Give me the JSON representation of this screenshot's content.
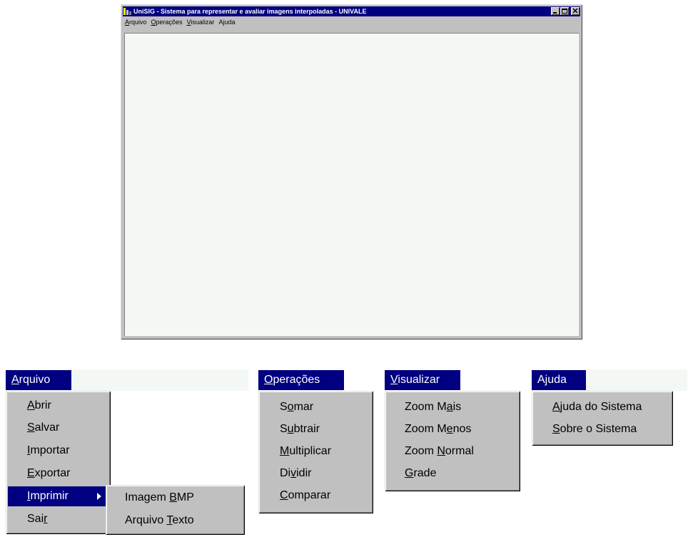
{
  "window": {
    "title": "UniSIG - Sistema para representar e avaliar imagens interpoladas - UNIVALE",
    "menu": [
      "Arquivo",
      "Operações",
      "Visualizar",
      "Ajuda"
    ]
  },
  "menus": {
    "arquivo": {
      "header": [
        "",
        "A",
        "rquivo"
      ],
      "items": [
        [
          "",
          "A",
          "brir"
        ],
        [
          "",
          "S",
          "alvar"
        ],
        [
          "",
          "I",
          "mportar"
        ],
        [
          "",
          "E",
          "xportar"
        ],
        [
          "",
          "I",
          "mprimir"
        ],
        [
          "Sai",
          "r",
          ""
        ]
      ],
      "submenu": [
        [
          "Imagem ",
          "B",
          "MP"
        ],
        [
          "Arquivo ",
          "T",
          "exto"
        ]
      ]
    },
    "operacoes": {
      "header": [
        "",
        "O",
        "perações"
      ],
      "items": [
        [
          "S",
          "o",
          "mar"
        ],
        [
          "S",
          "u",
          "btrair"
        ],
        [
          "",
          "M",
          "ultiplicar"
        ],
        [
          "Di",
          "v",
          "idir"
        ],
        [
          "",
          "C",
          "omparar"
        ]
      ]
    },
    "visualizar": {
      "header": [
        "",
        "V",
        "isualizar"
      ],
      "items": [
        [
          "Zoom M",
          "a",
          "is"
        ],
        [
          "Zoom M",
          "e",
          "nos"
        ],
        [
          "Zoom ",
          "N",
          "ormal"
        ],
        [
          "",
          "G",
          "rade"
        ]
      ]
    },
    "ajuda": {
      "header": [
        "A",
        "j",
        "uda"
      ],
      "items": [
        [
          "",
          "A",
          "juda do Sistema"
        ],
        [
          "",
          "S",
          "obre o Sistema"
        ]
      ]
    }
  },
  "colors": {
    "highlight": "#000080",
    "face": "#c0c0c0",
    "client": "#f4f8f4"
  }
}
